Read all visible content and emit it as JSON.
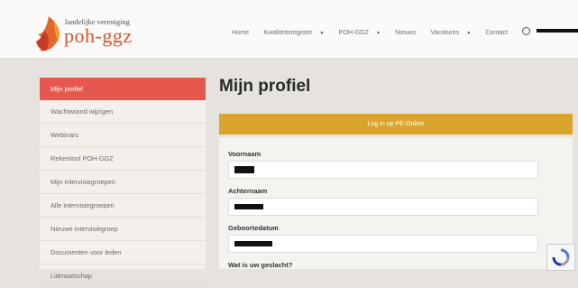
{
  "header": {
    "logo_top": "landelijke vereniging",
    "logo_main": "poh-ggz",
    "nav": [
      {
        "label": "Home",
        "dropdown": false
      },
      {
        "label": "Kwaliteitsregister",
        "dropdown": true
      },
      {
        "label": "POH-GGZ",
        "dropdown": true
      },
      {
        "label": "Nieuws",
        "dropdown": false
      },
      {
        "label": "Vacatures",
        "dropdown": true
      },
      {
        "label": "Contact",
        "dropdown": false
      }
    ]
  },
  "sidebar": {
    "items": [
      {
        "label": "Mijn profiel",
        "active": true
      },
      {
        "label": "Wachtwoord wijzigen"
      },
      {
        "label": "Webinars"
      },
      {
        "label": "Rekentool POH-GGZ"
      },
      {
        "label": "Mijn intervisiegroepen"
      },
      {
        "label": "Alle intervisiegroepen"
      },
      {
        "label": "Nieuwe intervisiegroep"
      },
      {
        "label": "Documenten voor leden"
      },
      {
        "label": "Lidmaatschap"
      }
    ]
  },
  "main": {
    "title": "Mijn profiel",
    "pe_button": "Log in op PE-Online",
    "fields": [
      {
        "label": "Voornaam"
      },
      {
        "label": "Achternaam"
      },
      {
        "label": "Geboortedatum"
      }
    ],
    "next_question": "Wat is uw geslacht?"
  },
  "colors": {
    "brand_orange": "#d8542c",
    "active_item": "#e6584e",
    "pe_button": "#d9a52c"
  },
  "icons": [
    "flame-logo-icon",
    "user-icon",
    "chevron-down-icon",
    "recaptcha-icon"
  ]
}
